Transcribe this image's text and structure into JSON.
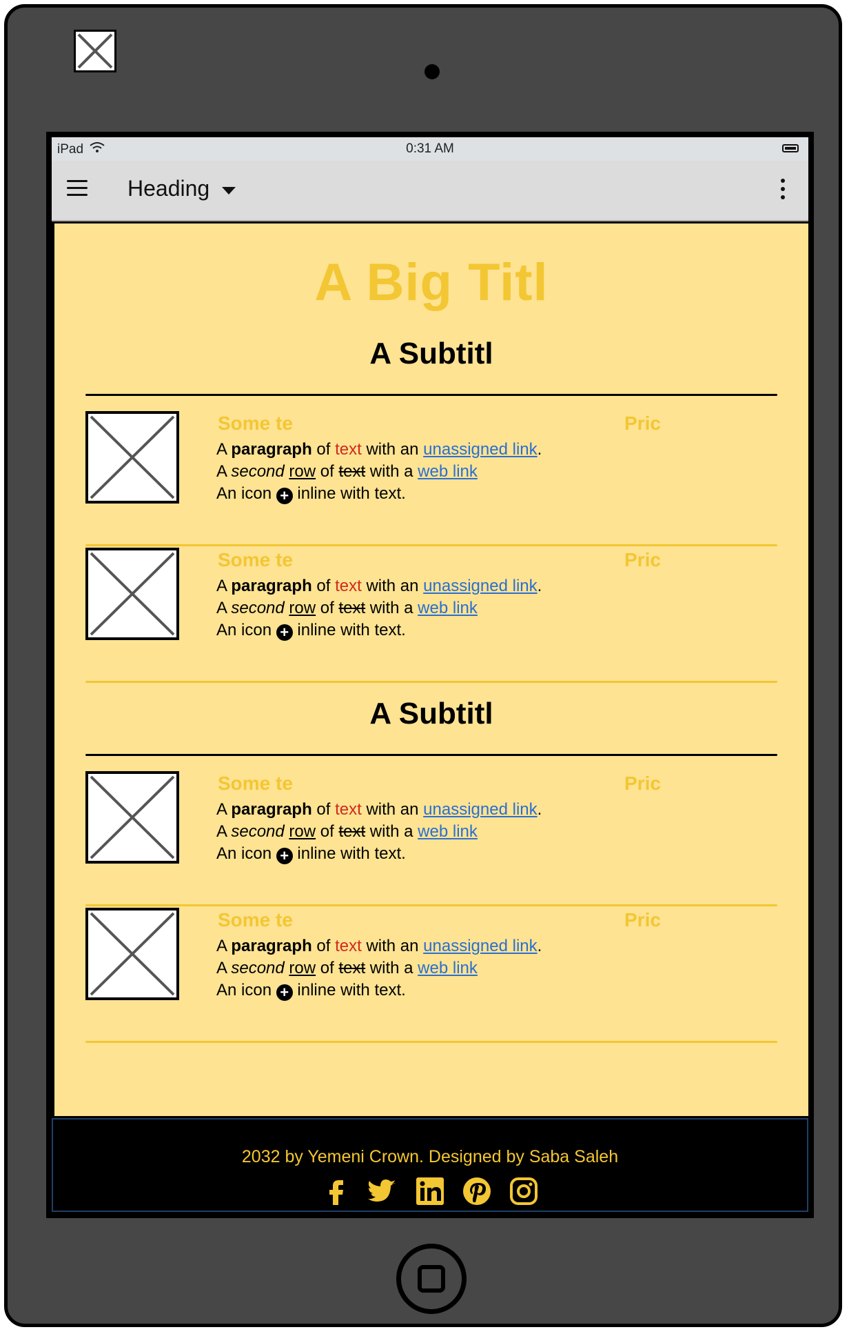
{
  "status_bar": {
    "device": "iPad",
    "time": "0:31 AM"
  },
  "app_bar": {
    "title": "Heading"
  },
  "content": {
    "big_title": "A Big Titl",
    "subtitle_1": "A Subtitl",
    "subtitle_2": "A Subtitl",
    "card": {
      "title": "Some te",
      "price": "Pric",
      "line1": {
        "a": "A ",
        "bold": "paragraph",
        "b": " of ",
        "red": "text",
        "c": " with an ",
        "link": "unassigned link",
        "d": "."
      },
      "line2": {
        "a": "A ",
        "italic": "second",
        "b": " ",
        "underline": "row",
        "c": " of ",
        "strike": "text",
        "d": " with a ",
        "link": "web link"
      },
      "line3": {
        "a": "An icon ",
        "icon": "+",
        "b": " inline with text."
      }
    }
  },
  "footer": {
    "text": "2032 by Yemeni Crown. Designed by Saba Saleh",
    "icons": [
      "facebook-icon",
      "twitter-icon",
      "linkedin-icon",
      "pinterest-icon",
      "instagram-icon"
    ]
  },
  "colors": {
    "accent": "#f3c633",
    "content_bg": "#fde392",
    "link": "#2a6fd1",
    "red_text": "#d02a1e"
  }
}
